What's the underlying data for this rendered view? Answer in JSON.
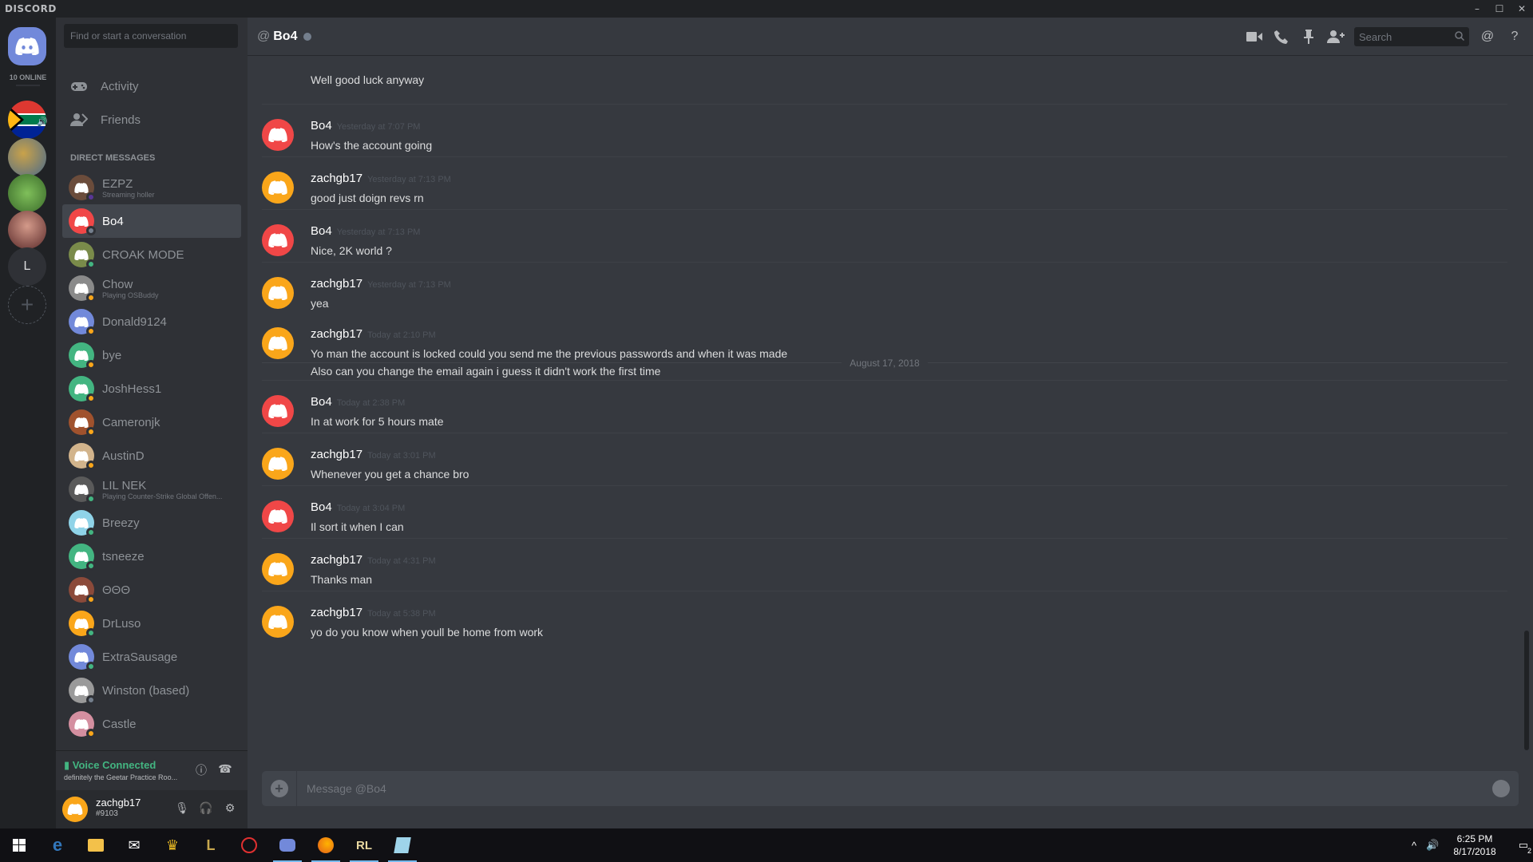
{
  "window": {
    "brand": "DISCORD",
    "controls": [
      "–",
      "☐",
      "✕"
    ]
  },
  "guilds": {
    "online_count": "10 ONLINE",
    "letter_server": "L",
    "add_label": "+"
  },
  "sidebar": {
    "search_placeholder": "Find or start a conversation",
    "nav": [
      {
        "label": "Activity",
        "icon": "gamepad-icon"
      },
      {
        "label": "Friends",
        "icon": "friends-icon"
      }
    ],
    "dm_header": "Direct Messages",
    "dms": [
      {
        "name": "EZPZ",
        "sub": "Streaming holler",
        "status": "#593695",
        "color": "#6b4c3b"
      },
      {
        "name": "Bo4",
        "sub": "",
        "status": "#747f8d",
        "color": "#f04747",
        "selected": true
      },
      {
        "name": "CROAK MODE",
        "sub": "",
        "status": "#43b581",
        "color": "#7a8b4a"
      },
      {
        "name": "Chow",
        "sub": "Playing OSBuddy",
        "status": "#faa61a",
        "color": "#8a8a8a"
      },
      {
        "name": "Donald9124",
        "sub": "",
        "status": "#faa61a",
        "color": "#7289da"
      },
      {
        "name": "bye",
        "sub": "",
        "status": "#faa61a",
        "color": "#43b581"
      },
      {
        "name": "JoshHess1",
        "sub": "",
        "status": "#faa61a",
        "color": "#43b581"
      },
      {
        "name": "Cameronjk",
        "sub": "",
        "status": "#faa61a",
        "color": "#a0522d"
      },
      {
        "name": "AustinD",
        "sub": "",
        "status": "#faa61a",
        "color": "#d2b48c"
      },
      {
        "name": "LIL NEK",
        "sub": "Playing Counter-Strike Global Offen...",
        "status": "#43b581",
        "color": "#5a5a5a"
      },
      {
        "name": "Breezy",
        "sub": "",
        "status": "#43b581",
        "color": "#8fd3e8"
      },
      {
        "name": "tsneeze",
        "sub": "",
        "status": "#43b581",
        "color": "#43b581"
      },
      {
        "name": "ΘΘΘ",
        "sub": "",
        "status": "#faa61a",
        "color": "#8b4a3a"
      },
      {
        "name": "DrLuso",
        "sub": "",
        "status": "#43b581",
        "color": "#faa61a"
      },
      {
        "name": "ExtraSausage",
        "sub": "",
        "status": "#43b581",
        "color": "#7289da"
      },
      {
        "name": "Winston (based)",
        "sub": "",
        "status": "#747f8d",
        "color": "#9a9a9a"
      },
      {
        "name": "Castle",
        "sub": "",
        "status": "#faa61a",
        "color": "#d48fa0"
      }
    ],
    "voice": {
      "status": "Voice Connected",
      "channel": "definitely the Geetar Practice Roo..."
    },
    "user": {
      "name": "zachgb17",
      "tag": "#9103"
    }
  },
  "chat": {
    "at": "@",
    "title": "Bo4",
    "search_placeholder": "Search",
    "first_line": "Well good luck anyway",
    "divider_date": "August 17, 2018",
    "composer_placeholder": "Message @Bo4",
    "messages": [
      {
        "author": "Bo4",
        "time": "Yesterday at 7:07 PM",
        "lines": [
          "How's the account going"
        ],
        "color": "#f04747"
      },
      {
        "author": "zachgb17",
        "time": "Yesterday at 7:13 PM",
        "lines": [
          "good just doign revs rn"
        ],
        "color": "#faa61a"
      },
      {
        "author": "Bo4",
        "time": "Yesterday at 7:13 PM",
        "lines": [
          "Nice, 2K world ?"
        ],
        "color": "#f04747"
      },
      {
        "author": "zachgb17",
        "time": "Yesterday at 7:13 PM",
        "lines": [
          "yea"
        ],
        "color": "#faa61a"
      },
      {
        "author": "zachgb17",
        "time": "Today at 2:10 PM",
        "lines": [
          "Yo man the account is locked could you send me the previous passwords and when it was made",
          "Also can you change the email again i guess it didn't work the first time"
        ],
        "color": "#faa61a"
      },
      {
        "author": "Bo4",
        "time": "Today at 2:38 PM",
        "lines": [
          "In at work for 5 hours mate"
        ],
        "color": "#f04747"
      },
      {
        "author": "zachgb17",
        "time": "Today at 3:01 PM",
        "lines": [
          "Whenever you get a chance bro"
        ],
        "color": "#faa61a"
      },
      {
        "author": "Bo4",
        "time": "Today at 3:04 PM",
        "lines": [
          "Il sort it when I can"
        ],
        "color": "#f04747"
      },
      {
        "author": "zachgb17",
        "time": "Today at 4:31 PM",
        "lines": [
          "Thanks man"
        ],
        "color": "#faa61a"
      },
      {
        "author": "zachgb17",
        "time": "Today at 5:38 PM",
        "lines": [
          "yo do you know when youll be home from work"
        ],
        "color": "#faa61a"
      }
    ]
  },
  "taskbar": {
    "time": "6:25 PM",
    "date": "8/17/2018",
    "notification_count": "2"
  }
}
